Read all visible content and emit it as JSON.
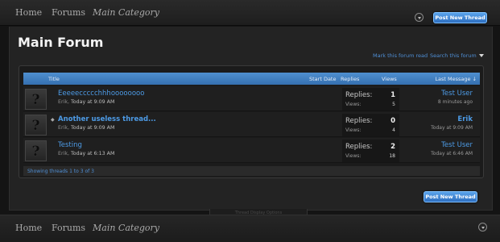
{
  "top_nav": {
    "items": [
      "Home",
      "Forums",
      "Main Category"
    ],
    "post_button": "Post New Thread"
  },
  "page": {
    "title": "Main Forum",
    "mark_read": "Mark this forum read",
    "search_forum": "Search this forum"
  },
  "table": {
    "headers": {
      "title": "Title",
      "start_date": "Start Date",
      "replies": "Replies",
      "views": "Views",
      "last_message": "Last Message ↓"
    },
    "rows": [
      {
        "avatar": "?",
        "title": "Eeeeeccccchhhoooooooo",
        "author": "Erik,",
        "date": "Today at 9:09 AM",
        "replies_label": "Replies:",
        "replies": "1",
        "views_label": "Views:",
        "views": "5",
        "last_user": "Test User",
        "last_time": "8 minutes ago"
      },
      {
        "avatar": "?",
        "sticky": "◆",
        "title": "Another useless thread...",
        "author": "Erik,",
        "date": "Today at 9:09 AM",
        "replies_label": "Replies:",
        "replies": "0",
        "views_label": "Views:",
        "views": "4",
        "last_user": "Erik",
        "last_time": "Today at 9:09 AM"
      },
      {
        "avatar": "?",
        "title": "Testing",
        "author": "Erik,",
        "date": "Today at 6:13 AM",
        "replies_label": "Replies:",
        "replies": "2",
        "views_label": "Views:",
        "views": "18",
        "last_user": "Test User",
        "last_time": "Today at 6:46 AM"
      }
    ],
    "footer": "Showing threads 1 to 3 of 3"
  },
  "tab_text": "Thread Display Options",
  "bottom": {
    "post_button": "Post New Thread"
  },
  "bottom_nav": {
    "items": [
      "Home",
      "Forums",
      "Main Category"
    ]
  },
  "colors": {
    "accent": "#4d9be6",
    "header_blue": "#3f7fc2",
    "background": "#141414"
  },
  "icons": [
    "chevron-down-icon",
    "question-mark-avatar",
    "dropdown-arrow-icon"
  ]
}
